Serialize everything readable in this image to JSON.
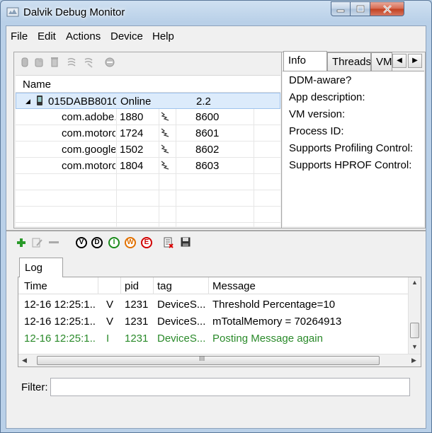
{
  "window": {
    "title": "Dalvik Debug Monitor"
  },
  "menu": [
    "File",
    "Edit",
    "Actions",
    "Device",
    "Help"
  ],
  "devices": {
    "columns": [
      "Name",
      "",
      "",
      ""
    ],
    "device": {
      "name": "015DABB8010",
      "status": "Online",
      "version": "2.2"
    },
    "processes": [
      {
        "name": "com.adobe.",
        "pid": "1880",
        "port": "8600"
      },
      {
        "name": "com.motoro",
        "pid": "1724",
        "port": "8601"
      },
      {
        "name": "com.google",
        "pid": "1502",
        "port": "8602"
      },
      {
        "name": "com.motoro",
        "pid": "1804",
        "port": "8603"
      }
    ]
  },
  "info_tabs": {
    "tabs": [
      "Info",
      "Threads",
      "VM"
    ],
    "active": "Info"
  },
  "info_lines": [
    "DDM-aware?",
    "App description:",
    "VM version:",
    "Process ID:",
    "Supports Profiling Control:",
    "Supports HPROF Control:"
  ],
  "log_levels": [
    "V",
    "D",
    "I",
    "W",
    "E"
  ],
  "log_level_colors": {
    "V": "#000000",
    "D": "#000000",
    "I": "#1a8a1a",
    "W": "#e07000",
    "E": "#d00000"
  },
  "log": {
    "tab_label": "Log",
    "columns": [
      "Time",
      "",
      "pid",
      "tag",
      "Message"
    ],
    "rows": [
      {
        "time": "12-16 12:25:1...",
        "level": "V",
        "pid": "1231",
        "tag": "DeviceS...",
        "message": "Threshold Percentage=10",
        "color": "#000000"
      },
      {
        "time": "12-16 12:25:1...",
        "level": "V",
        "pid": "1231",
        "tag": "DeviceS...",
        "message": "mTotalMemory = 70264913",
        "color": "#000000"
      },
      {
        "time": "12-16 12:25:1...",
        "level": "I",
        "pid": "1231",
        "tag": "DeviceS...",
        "message": "Posting Message again",
        "color": "#2a8a2a"
      }
    ],
    "hscroll_grip": "III"
  },
  "filter": {
    "label": "Filter:",
    "value": ""
  }
}
